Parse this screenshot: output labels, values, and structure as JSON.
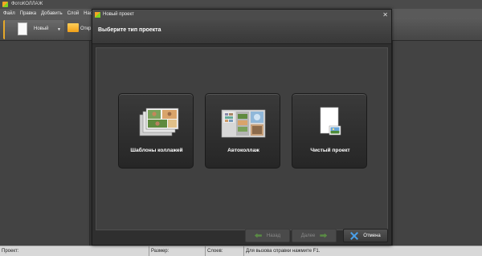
{
  "app": {
    "title": "ФотоКОЛЛАЖ"
  },
  "menu": [
    "Файл",
    "Правка",
    "Добавить",
    "Слой",
    "Наст"
  ],
  "toolbar": {
    "new_label": "Новый",
    "open_label": "Откр"
  },
  "dialog": {
    "title": "Новый проект",
    "heading": "Выберите тип проекта",
    "cards": [
      {
        "label": "Шаблоны коллажей"
      },
      {
        "label": "Автоколлаж"
      },
      {
        "label": "Чистый проект"
      }
    ],
    "buttons": {
      "back": "Назад",
      "next": "Далее",
      "cancel": "Отмена"
    }
  },
  "status": {
    "project": "Проект:",
    "size": "Размер:",
    "layers": "Слоев:",
    "help": "Для вызова справки нажмите F1."
  }
}
